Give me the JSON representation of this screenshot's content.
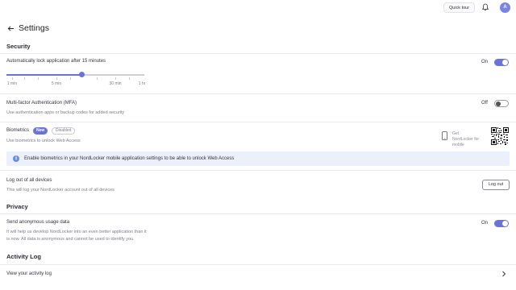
{
  "topbar": {
    "quick_tour": "Quick tour",
    "avatar_initial": "A",
    "bell_icon": "bell-icon"
  },
  "header": {
    "title": "Settings",
    "back_icon": "arrow-left-icon"
  },
  "security": {
    "heading": "Security",
    "autolock": {
      "title": "Automatically lock application after 15 minutes",
      "toggle_label": "On",
      "enabled": true,
      "slider": {
        "labels": [
          "1 min",
          "5 min",
          "30 min",
          "1 hr"
        ],
        "selected_value": "15 minutes"
      }
    },
    "mfa": {
      "title": "Multi-factor Authentication (MFA)",
      "subtitle": "Use authentication apps or backup codes for added security",
      "toggle_label": "Off",
      "enabled": false
    },
    "biometrics": {
      "title": "Biometrics",
      "badge_new": "New",
      "badge_disabled": "Disabled",
      "subtitle": "Use biometrics to unlock Web Access",
      "get_app": "Get NordLocker for mobile",
      "phone_icon": "smartphone-icon",
      "qr_icon": "qr-code-icon"
    },
    "info": {
      "text": "Enable biometrics in your NordLocker mobile application settings to be able to unlock Web Access",
      "icon": "info-icon"
    },
    "logout": {
      "title": "Log out of all devices",
      "subtitle": "This will log your NordLocker account out of all devices",
      "button": "Log out"
    }
  },
  "privacy": {
    "heading": "Privacy",
    "usage": {
      "title": "Send anonymous usage data",
      "subtitle_line1": "It will help us develop NordLocker into an even better application than it",
      "subtitle_line2": "is now. All data is anonymous and cannot be used to identify you.",
      "toggle_label": "On",
      "enabled": true
    }
  },
  "activity": {
    "heading": "Activity Log",
    "view_log": "View your activity log",
    "chevron_icon": "chevron-right-icon"
  },
  "colors": {
    "accent": "#6b72d8",
    "info_bg": "#ecf0fb",
    "divider": "#e8e8ee"
  }
}
